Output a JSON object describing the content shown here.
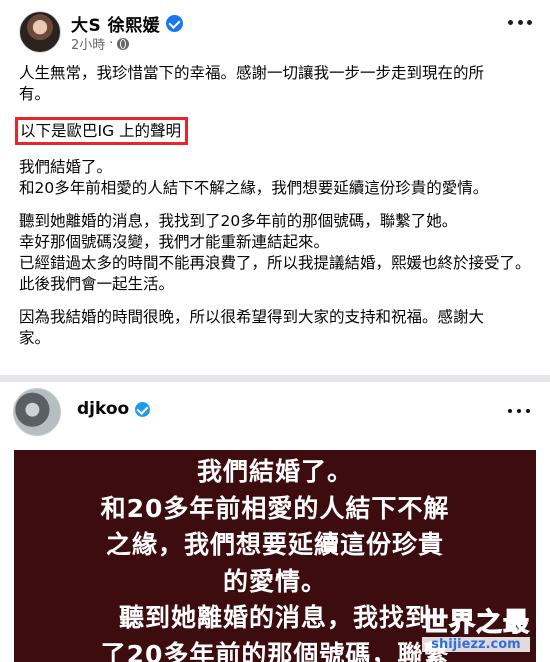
{
  "post": {
    "author": "大S 徐熙媛",
    "time": "2小時",
    "separator": "·",
    "body_lines_1": [
      "人生無常，我珍惜當下的幸福。感謝一切讓我一步一步走到現在的所",
      "有。"
    ],
    "highlight": "以下是歐巴IG 上的聲明",
    "para_1": [
      "我們結婚了。",
      "和20多年前相愛的人結下不解之緣，我們想要延續這份珍貴的愛情。"
    ],
    "para_2": [
      "聽到她離婚的消息，我找到了20多年前的那個號碼，聯繫了她。",
      "幸好那個號碼沒變，我們才能重新連結起來。",
      "已經錯過太多的時間不能再浪費了，所以我提議結婚，熙媛也終於接受了。",
      "此後我們會一起生活。"
    ],
    "para_3": [
      "因為我結婚的時間很晚，所以很希望得到大家的支持和祝福。感謝大",
      "家。"
    ]
  },
  "ig": {
    "username": "djkoo",
    "story_lines": [
      "我們結婚了。",
      "和20多年前相愛的人結下不解",
      "之緣，我們想要延續這份珍貴",
      "的愛情。",
      "聽到她離婚的消息，我找到",
      "了20多年前的那個號碼，聯繫"
    ]
  },
  "watermark": {
    "title": "世界之最",
    "url": "shijiezz.com"
  },
  "icons": {
    "post_avatar": "profile-photo",
    "verified": "verified-badge-icon",
    "audience": "globe-icon",
    "more": "more-options-icon"
  },
  "colors": {
    "highlight_border": "#e8252b",
    "verified": "#1877f2",
    "story_bg": "#3d0c0f"
  }
}
